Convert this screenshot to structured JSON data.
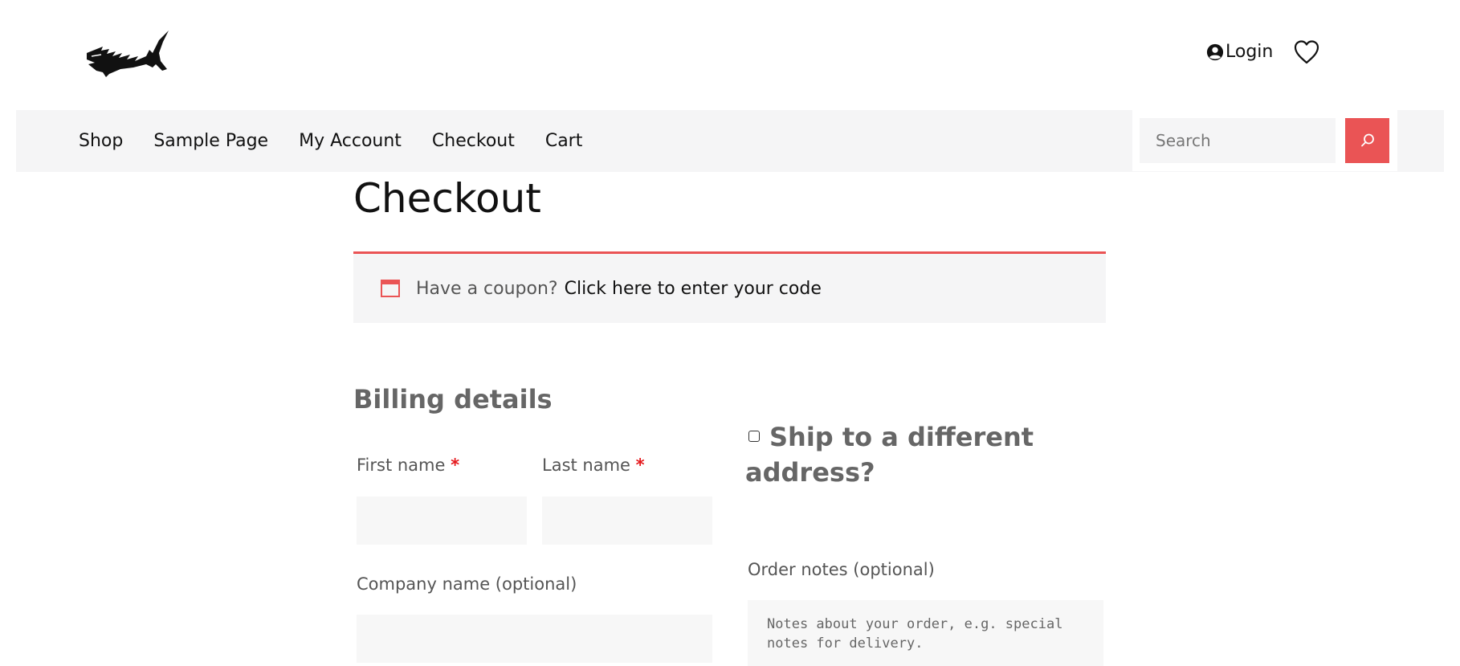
{
  "header": {
    "logo_alt": "SHARK",
    "login_label": "Login"
  },
  "nav": {
    "items": [
      "Shop",
      "Sample Page",
      "My Account",
      "Checkout",
      "Cart"
    ]
  },
  "search": {
    "placeholder": "Search"
  },
  "page": {
    "title": "Checkout"
  },
  "coupon": {
    "prompt": "Have a coupon?",
    "link": "Click here to enter your code"
  },
  "billing": {
    "heading": "Billing details",
    "first_name_label": "First name",
    "last_name_label": "Last name",
    "required_mark": "*",
    "company_label": "Company name (optional)"
  },
  "shipping": {
    "ship_different_label": "Ship to a different address?"
  },
  "order_notes": {
    "label": "Order notes (optional)",
    "placeholder": "Notes about your order, e.g. special notes for delivery."
  },
  "colors": {
    "accent": "#ea5455",
    "nav_bg": "#f5f5f6",
    "required": "#e5191d"
  }
}
